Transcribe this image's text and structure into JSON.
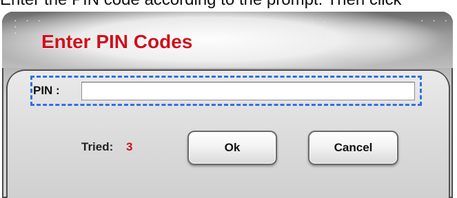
{
  "instruction_text": "Enter the PIN code according to the prompt. Then click",
  "dialog": {
    "title": "Enter PIN Codes",
    "pin_label": "PIN :",
    "pin_value": "",
    "pin_placeholder": "",
    "tried_label": "Tried:",
    "tried_count": "3",
    "ok_label": "Ok",
    "cancel_label": "Cancel"
  },
  "colors": {
    "title_red": "#d0101b",
    "highlight_blue": "#2e6fe6",
    "frame_dark": "#4a4a4a"
  },
  "icons": [
    "decorative-dot-pattern"
  ]
}
